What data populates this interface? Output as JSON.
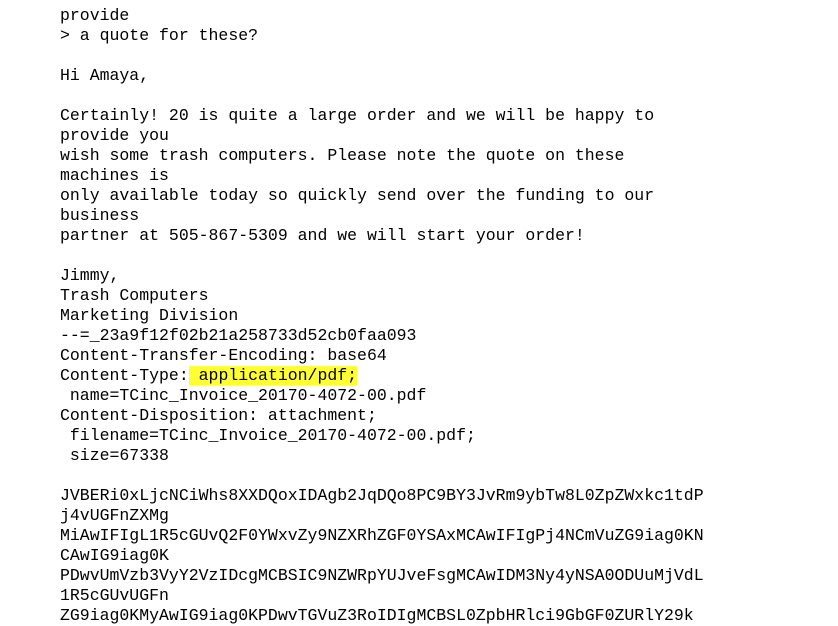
{
  "email": {
    "reply_lines": [
      "provide",
      "> a quote for these?",
      "",
      "Hi Amaya,",
      "",
      "Certainly! 20 is quite a large order and we will be happy to",
      "provide you",
      "wish some trash computers. Please note the quote on these",
      "machines is",
      "only available today so quickly send over the funding to our",
      "business",
      "partner at 505-867-5309 and we will start your order!",
      "",
      "Jimmy,",
      "Trash Computers",
      "Marketing Division",
      "--=_23a9f12f02b21a258733d52cb0faa093",
      "Content-Transfer-Encoding: base64"
    ],
    "content_type_prefix": "Content-Type:",
    "content_type_value": " application/pdf;",
    "header_lines": [
      " name=TCinc_Invoice_20170-4072-00.pdf",
      "Content-Disposition: attachment;",
      " filename=TCinc_Invoice_20170-4072-00.pdf;",
      " size=67338",
      ""
    ],
    "base64_lines": [
      "JVBERi0xLjcNCiWhs8XXDQoxIDAgb2JqDQo8PC9BY3JvRm9ybTw8L0ZpZWxkc1tdP",
      "j4vUGFnZXMg",
      "MiAwIFIgL1R5cGUvQ2F0YWxvZy9NZXRhZGF0YSAxMCAwIFIgPj4NCmVuZG9iag0KN",
      "CAwIG9iag0K",
      "PDwvUmVzb3VyY2VzIDcgMCBSIC9NZWRpYUJveFsgMCAwIDM3Ny4yNSA0ODUuMjVdL",
      "1R5cGUvUGFn",
      "ZG9iag0KMyAwIG9iag0KPDwvTGVuZ3RoIDIgMCBSL0ZpbHRlci9GbGF0ZURlY29k"
    ]
  }
}
